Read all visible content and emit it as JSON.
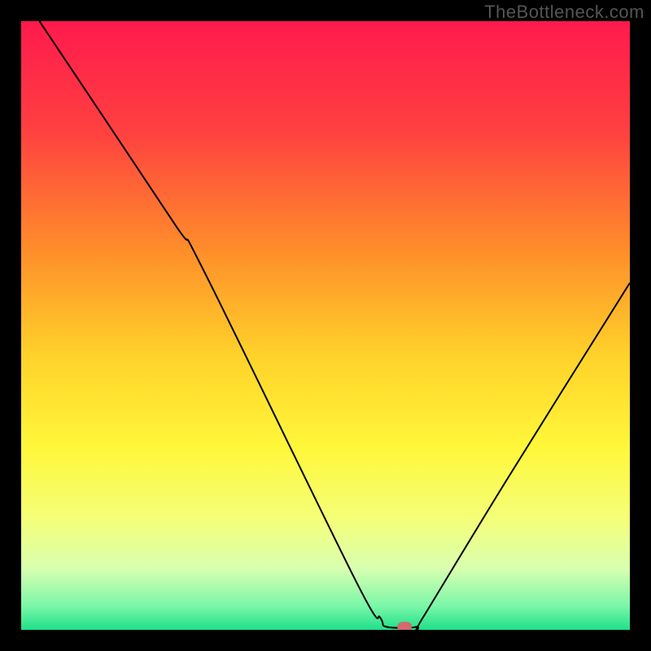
{
  "watermark": "TheBottleneck.com",
  "chart_data": {
    "type": "line",
    "title": "",
    "xlabel": "",
    "ylabel": "",
    "xlim": [
      0,
      100
    ],
    "ylim": [
      0,
      100
    ],
    "grid": false,
    "legend": false,
    "background": {
      "description": "vertical heatmap gradient, value = y-position",
      "stops": [
        {
          "y": 0,
          "color": "#ff1a4d"
        },
        {
          "y": 18,
          "color": "#ff4040"
        },
        {
          "y": 38,
          "color": "#ff8f2a"
        },
        {
          "y": 55,
          "color": "#ffd22a"
        },
        {
          "y": 70,
          "color": "#fff73a"
        },
        {
          "y": 82,
          "color": "#f4ff7a"
        },
        {
          "y": 90,
          "color": "#d8ffb0"
        },
        {
          "y": 96,
          "color": "#7cf7a9"
        },
        {
          "y": 100,
          "color": "#1fe08a"
        }
      ]
    },
    "series": [
      {
        "name": "bottleneck-curve",
        "color": "#000000",
        "stroke_width": 2,
        "points": [
          {
            "x": 3,
            "y": 100
          },
          {
            "x": 25,
            "y": 67
          },
          {
            "x": 30,
            "y": 59
          },
          {
            "x": 55,
            "y": 8
          },
          {
            "x": 59,
            "y": 2
          },
          {
            "x": 60,
            "y": 0.5
          },
          {
            "x": 65,
            "y": 0.5
          },
          {
            "x": 66,
            "y": 2
          },
          {
            "x": 80,
            "y": 25
          },
          {
            "x": 100,
            "y": 57
          }
        ]
      }
    ],
    "marker": {
      "name": "minimum-point",
      "x": 63,
      "y": 0.5,
      "color": "#d46a6a",
      "shape": "pill",
      "width": 2.4,
      "height": 1.6
    }
  }
}
